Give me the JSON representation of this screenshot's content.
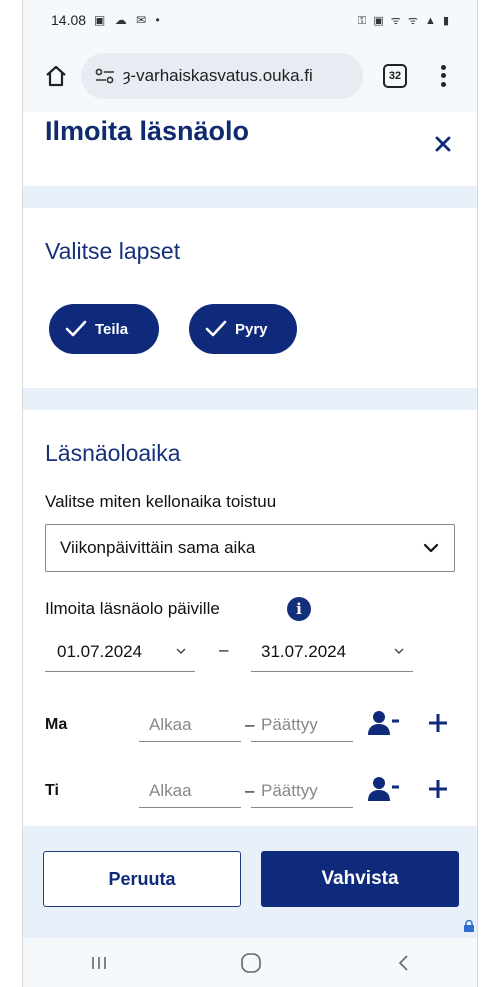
{
  "status_bar": {
    "time": "14.08",
    "left_icons": "▣ ☁ ✉ •",
    "right_icons": "⚿ ▣ ᯤ ᯤ ▲ ▮"
  },
  "browser": {
    "url": "ȝ-varhaiskasvatus.ouka.fi",
    "tab_count": "32",
    "icons": [
      "home-icon",
      "site-settings-icon",
      "tabs-icon",
      "overflow-menu-icon"
    ]
  },
  "dialog": {
    "title": "Ilmoita läsnäolo",
    "close_icon": "close-icon"
  },
  "children_section": {
    "title": "Valitse lapset",
    "children": [
      {
        "label": "Teila",
        "selected": true
      },
      {
        "label": "Pyry",
        "selected": true
      }
    ]
  },
  "attendance_section": {
    "title": "Läsnäoloaika",
    "repeat_label": "Valitse miten kellonaika toistuu",
    "repeat_value": "Viikonpäivittäin sama aika",
    "days_label": "Ilmoita läsnäolo päiville",
    "date_from": "01.07.2024",
    "date_to": "31.07.2024",
    "date_separator": "–",
    "rows": [
      {
        "day": "Ma",
        "start_placeholder": "Alkaa",
        "end_placeholder": "Päättyy",
        "separator": "–"
      },
      {
        "day": "Ti",
        "start_placeholder": "Alkaa",
        "end_placeholder": "Päättyy",
        "separator": "–"
      }
    ]
  },
  "footer": {
    "cancel_label": "Peruuta",
    "confirm_label": "Vahvista"
  },
  "colors": {
    "primary": "#0f2a7a",
    "band": "#e8f0f9",
    "text": "#111111"
  }
}
